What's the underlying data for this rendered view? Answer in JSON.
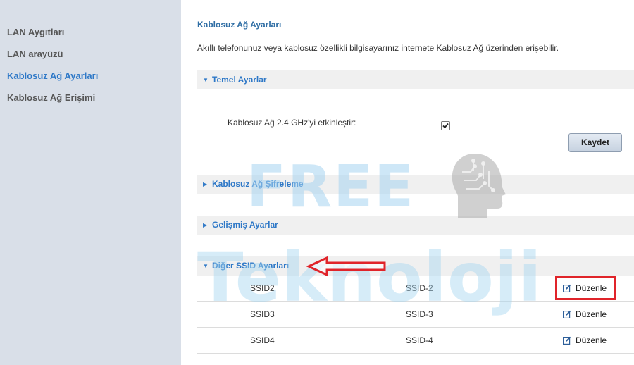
{
  "sidebar": {
    "items": [
      {
        "label": "LAN Aygıtları",
        "active": false
      },
      {
        "label": "LAN arayüzü",
        "active": false
      },
      {
        "label": "Kablosuz Ağ Ayarları",
        "active": true
      },
      {
        "label": "Kablosuz Ağ Erişimi",
        "active": false
      }
    ]
  },
  "main": {
    "title": "Kablosuz Ağ Ayarları",
    "description": "Akıllı telefonunuz veya kablosuz özellikli bilgisayarınız internete Kablosuz Ağ üzerinden erişebilir.",
    "sections": [
      {
        "label": "Temel Ayarlar",
        "expanded": true,
        "caret": "▼"
      },
      {
        "label": "Kablosuz Ağ Şifreleme",
        "expanded": false,
        "caret": "▶"
      },
      {
        "label": "Gelişmiş Ayarlar",
        "expanded": false,
        "caret": "▶"
      },
      {
        "label": "Diğer SSID Ayarları",
        "expanded": true,
        "caret": "▼"
      }
    ],
    "basic": {
      "enable_label": "Kablosuz Ağ 2.4 GHz'yi etkinleştir:",
      "enabled": true,
      "save_label": "Kaydet"
    },
    "ssid_rows": [
      {
        "name": "SSID2",
        "value": "SSID-2",
        "action": "Düzenle"
      },
      {
        "name": "SSID3",
        "value": "SSID-3",
        "action": "Düzenle"
      },
      {
        "name": "SSID4",
        "value": "SSID-4",
        "action": "Düzenle"
      }
    ]
  },
  "watermark": {
    "line1": "FREE",
    "line2": "Teknoloji"
  },
  "colors": {
    "sidebar_bg": "#d9dfe8",
    "accent": "#2e78c7",
    "section_bg": "#f0f0f0",
    "highlight": "#e0242a"
  },
  "icons": {
    "section_expanded": "caret-down-icon",
    "section_collapsed": "caret-right-icon",
    "edit": "edit-icon",
    "annotation": "red-arrow-icon"
  }
}
